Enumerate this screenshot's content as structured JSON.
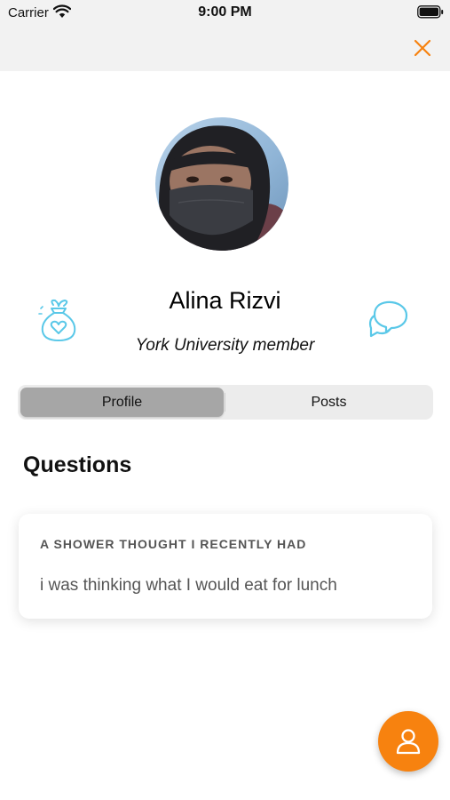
{
  "status_bar": {
    "carrier": "Carrier",
    "time": "9:00 PM"
  },
  "nav": {
    "close_icon": "close-icon"
  },
  "profile": {
    "name": "Alina Rizvi",
    "affiliation": "York University member",
    "gift_icon": "gift-bag-icon",
    "chat_icon": "chat-bubbles-icon"
  },
  "tabs": [
    {
      "label": "Profile",
      "selected": true
    },
    {
      "label": "Posts",
      "selected": false
    }
  ],
  "questions": {
    "title": "Questions",
    "items": [
      {
        "prompt": "A SHOWER THOUGHT I RECENTLY HAD",
        "answer": "i was thinking what I would eat for lunch"
      }
    ]
  },
  "fab": {
    "icon": "person-icon"
  },
  "colors": {
    "accent": "#f7820f",
    "icon_blue": "#5ac8e8",
    "segment_selected": "#a6a6a6"
  }
}
